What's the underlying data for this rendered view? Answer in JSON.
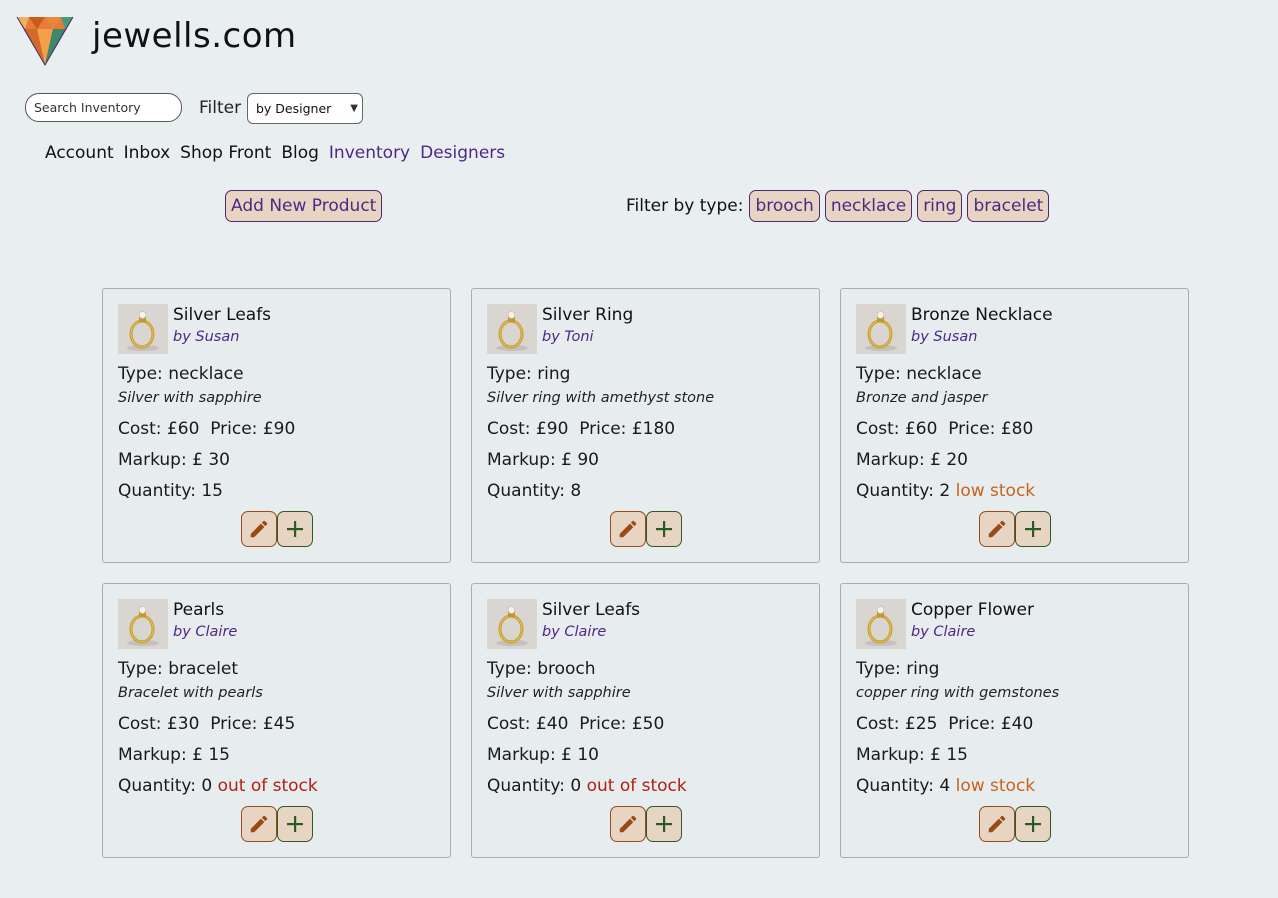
{
  "site": {
    "name": "jewells.com"
  },
  "search": {
    "placeholder": "Search Inventory"
  },
  "filter": {
    "label": "Filter",
    "selected": "by Designer"
  },
  "nav": {
    "items": [
      {
        "label": "Account",
        "active": false
      },
      {
        "label": "Inbox",
        "active": false
      },
      {
        "label": "Shop Front",
        "active": false
      },
      {
        "label": "Blog",
        "active": false
      },
      {
        "label": "Inventory",
        "active": true
      },
      {
        "label": "Designers",
        "active": true
      }
    ]
  },
  "actions": {
    "add_product_label": "Add New Product"
  },
  "type_filter": {
    "label": "Filter by type:",
    "types": [
      "brooch",
      "necklace",
      "ring",
      "bracelet"
    ]
  },
  "labels": {
    "type": "Type:",
    "cost": "Cost:",
    "price": "Price:",
    "markup": "Markup:",
    "quantity": "Quantity:"
  },
  "colors": {
    "accent": "#4b2a86",
    "low_stock": "#c8631d",
    "out_of_stock": "#b01f14",
    "button_bg": "#e8d4c2"
  },
  "products": [
    {
      "name": "Silver Leafs",
      "designer": "by Susan",
      "type": "necklace",
      "description": "Silver with sapphire",
      "cost": "£60",
      "price": "£90",
      "markup": "£ 30",
      "quantity": "15",
      "stock_status": "",
      "stock_level": "ok"
    },
    {
      "name": "Silver Ring",
      "designer": "by Toni",
      "type": "ring",
      "description": "Silver ring with amethyst stone",
      "cost": "£90",
      "price": "£180",
      "markup": "£ 90",
      "quantity": "8",
      "stock_status": "",
      "stock_level": "ok"
    },
    {
      "name": "Bronze Necklace",
      "designer": "by Susan",
      "type": "necklace",
      "description": "Bronze and jasper",
      "cost": "£60",
      "price": "£80",
      "markup": "£ 20",
      "quantity": "2",
      "stock_status": "low stock",
      "stock_level": "low"
    },
    {
      "name": "Pearls",
      "designer": "by Claire",
      "type": "bracelet",
      "description": "Bracelet with pearls",
      "cost": "£30",
      "price": "£45",
      "markup": "£ 15",
      "quantity": "0",
      "stock_status": "out of stock",
      "stock_level": "out"
    },
    {
      "name": "Silver Leafs",
      "designer": "by Claire",
      "type": "brooch",
      "description": "Silver with sapphire",
      "cost": "£40",
      "price": "£50",
      "markup": "£ 10",
      "quantity": "0",
      "stock_status": "out of stock",
      "stock_level": "out"
    },
    {
      "name": "Copper Flower",
      "designer": "by Claire",
      "type": "ring",
      "description": "copper ring with gemstones",
      "cost": "£25",
      "price": "£40",
      "markup": "£ 15",
      "quantity": "4",
      "stock_status": "low stock",
      "stock_level": "low"
    }
  ]
}
